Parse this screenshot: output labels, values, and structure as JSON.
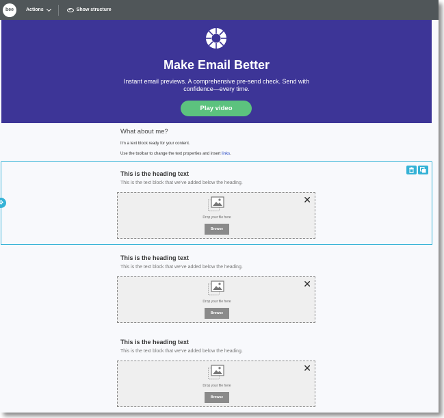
{
  "toolbar": {
    "logo_text": "bee",
    "actions_label": "Actions",
    "show_structure_label": "Show structure"
  },
  "hero": {
    "icon": "wheel-logo-icon",
    "title": "Make Email Better",
    "subtitle": "Instant email previews. A comprehensive pre-send check. Send with confidence—every time.",
    "button_label": "Play video",
    "bg_color": "#3d3597",
    "button_color": "#5cc27e"
  },
  "intro": {
    "heading": "What about me?",
    "line1": "I'm a text block ready for your content.",
    "line2_prefix": "Use the toolbar to change the text properties and insert ",
    "link_text": "links",
    "line2_suffix": "."
  },
  "selection": {
    "accent_color": "#35b2d6",
    "delete_icon": "trash-icon",
    "duplicate_icon": "duplicate-icon",
    "move_icon": "move-icon"
  },
  "sections": [
    {
      "heading": "This is the heading text",
      "text": "This is the text block that we've added below the heading.",
      "drop_text": "Drop your file here",
      "browse_label": "Browse"
    },
    {
      "heading": "This is the heading text",
      "text": "This is the text block that we've added below the heading.",
      "drop_text": "Drop your file here",
      "browse_label": "Browse"
    },
    {
      "heading": "This is the heading text",
      "text": "This is the text block that we've added below the heading.",
      "drop_text": "Drop your file here",
      "browse_label": "Browse"
    }
  ]
}
